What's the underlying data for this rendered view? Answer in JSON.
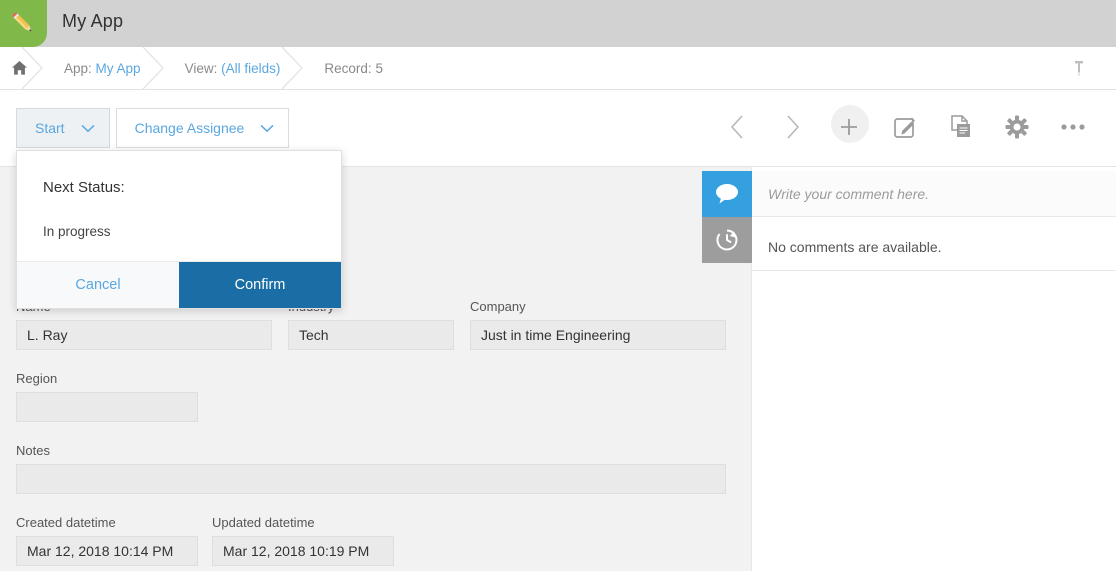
{
  "app": {
    "title": "My App",
    "icon": "pencil-app-icon",
    "icon_bg": "#81b84a"
  },
  "breadcrumb": {
    "home_icon": "home-icon",
    "pin_icon": "pin-icon",
    "items": [
      {
        "label": "App:",
        "value": "My App",
        "is_link": true
      },
      {
        "label": "View:",
        "value": "(All fields)",
        "is_link": true
      },
      {
        "label": "Record:",
        "value": "5",
        "is_link": false
      }
    ]
  },
  "toolbar": {
    "buttons": [
      {
        "label": "Start",
        "icon": "chevron-down-icon",
        "active": true
      },
      {
        "label": "Change Assignee",
        "icon": "chevron-down-icon",
        "active": false
      }
    ],
    "icons": [
      {
        "name": "previous-record-icon",
        "glyph": "chevron-left"
      },
      {
        "name": "next-record-icon",
        "glyph": "chevron-right"
      },
      {
        "name": "add-record-icon",
        "glyph": "plus"
      },
      {
        "name": "edit-record-icon",
        "glyph": "pencil-square"
      },
      {
        "name": "copy-record-icon",
        "glyph": "copy-document"
      },
      {
        "name": "settings-icon",
        "glyph": "gear"
      },
      {
        "name": "more-options-icon",
        "glyph": "ellipsis"
      }
    ]
  },
  "form": {
    "fields": [
      {
        "label": "Name",
        "value": "L. Ray"
      },
      {
        "label": "Industry",
        "value": "Tech"
      },
      {
        "label": "Company",
        "value": "Just in time Engineering"
      },
      {
        "label": "Region",
        "value": ""
      },
      {
        "label": "Notes",
        "value": ""
      },
      {
        "label": "Created datetime",
        "value": "Mar 12, 2018 10:14 PM"
      },
      {
        "label": "Updated datetime",
        "value": "Mar 12, 2018 10:19 PM"
      }
    ]
  },
  "comments_panel": {
    "tabs": [
      {
        "name": "comments-tab",
        "icon": "comment-bubble-icon",
        "active": true,
        "color": "#35a0e0"
      },
      {
        "name": "history-tab",
        "icon": "history-clock-icon",
        "active": false,
        "color": "#9d9d9d"
      }
    ],
    "input_placeholder": "Write your comment here.",
    "empty_message": "No comments are available."
  },
  "popup": {
    "title": "Next Status:",
    "value": "In progress",
    "cancel_label": "Cancel",
    "confirm_label": "Confirm",
    "confirm_color": "#1b6ea5"
  }
}
